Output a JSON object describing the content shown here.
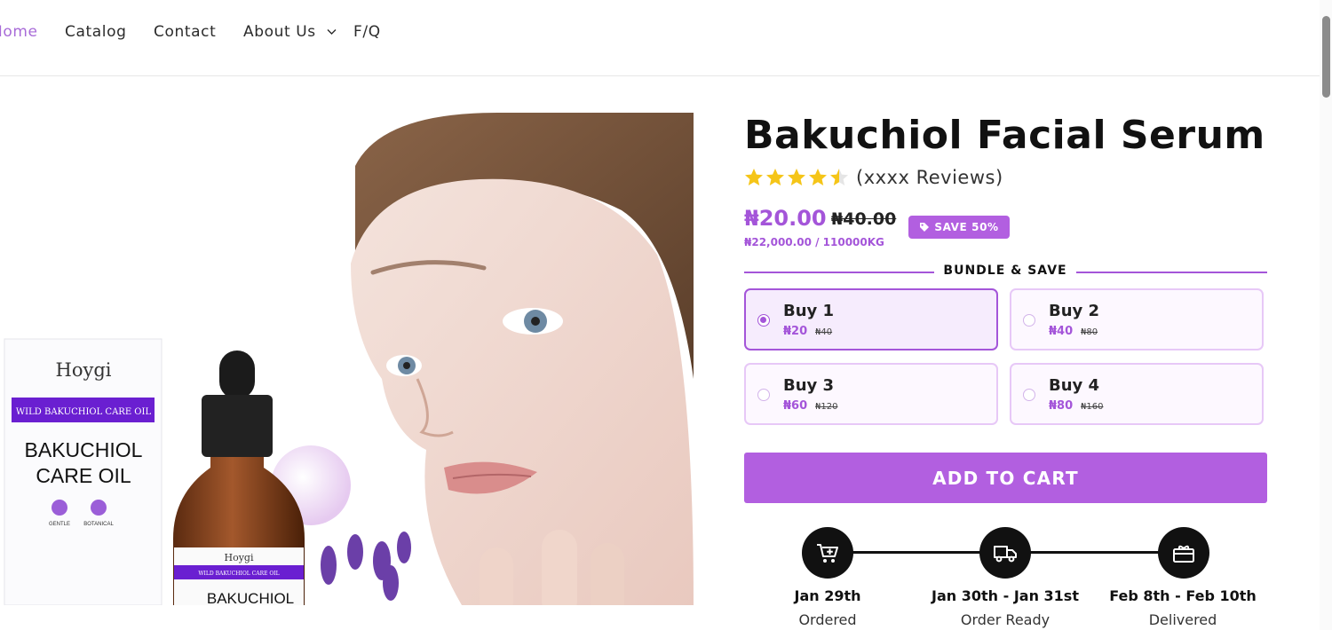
{
  "nav": {
    "items": [
      {
        "label": "Home",
        "active": true
      },
      {
        "label": "Catalog"
      },
      {
        "label": "Contact"
      },
      {
        "label": "About Us",
        "has_dropdown": true
      },
      {
        "label": "F/Q"
      }
    ]
  },
  "product": {
    "title": "Bakuchiol Facial Serum",
    "rating": 4.5,
    "reviews_text": "(xxxx Reviews)",
    "price": "₦20.00",
    "compare_price": "₦40.00",
    "save_badge": "SAVE 50%",
    "unit_price": "₦22,000.00 / 110000KG"
  },
  "hero_image": {
    "box_brand": "Hoygi",
    "box_banner": "WILD BAKUCHIOL CARE OIL",
    "box_title_1": "BAKUCHIOL",
    "box_title_2": "CARE OIL",
    "box_icon_1": "GENTLE",
    "box_icon_2": "BOTANICAL",
    "bottle_brand": "Hoygi",
    "bottle_banner": "WILD BAKUCHIOL CARE OIL",
    "bottle_title": "BAKUCHIOL"
  },
  "bundle": {
    "heading": "BUNDLE & SAVE",
    "options": [
      {
        "label": "Buy 1",
        "price": "₦20",
        "compare": "₦40",
        "selected": true
      },
      {
        "label": "Buy 2",
        "price": "₦40",
        "compare": "₦80",
        "selected": false
      },
      {
        "label": "Buy 3",
        "price": "₦60",
        "compare": "₦120",
        "selected": false
      },
      {
        "label": "Buy 4",
        "price": "₦80",
        "compare": "₦160",
        "selected": false
      }
    ]
  },
  "cart": {
    "label": "ADD TO CART"
  },
  "timeline": [
    {
      "icon": "cart-plus-icon",
      "date": "Jan 29th",
      "status": "Ordered"
    },
    {
      "icon": "truck-icon",
      "date": "Jan 30th - Jan 31st",
      "status": "Order Ready"
    },
    {
      "icon": "gift-icon",
      "date": "Feb 8th - Feb 10th",
      "status": "Delivered"
    }
  ],
  "colors": {
    "accent": "#a455d9",
    "button": "#b25fe0",
    "star": "#f5c518",
    "dark": "#111111"
  }
}
